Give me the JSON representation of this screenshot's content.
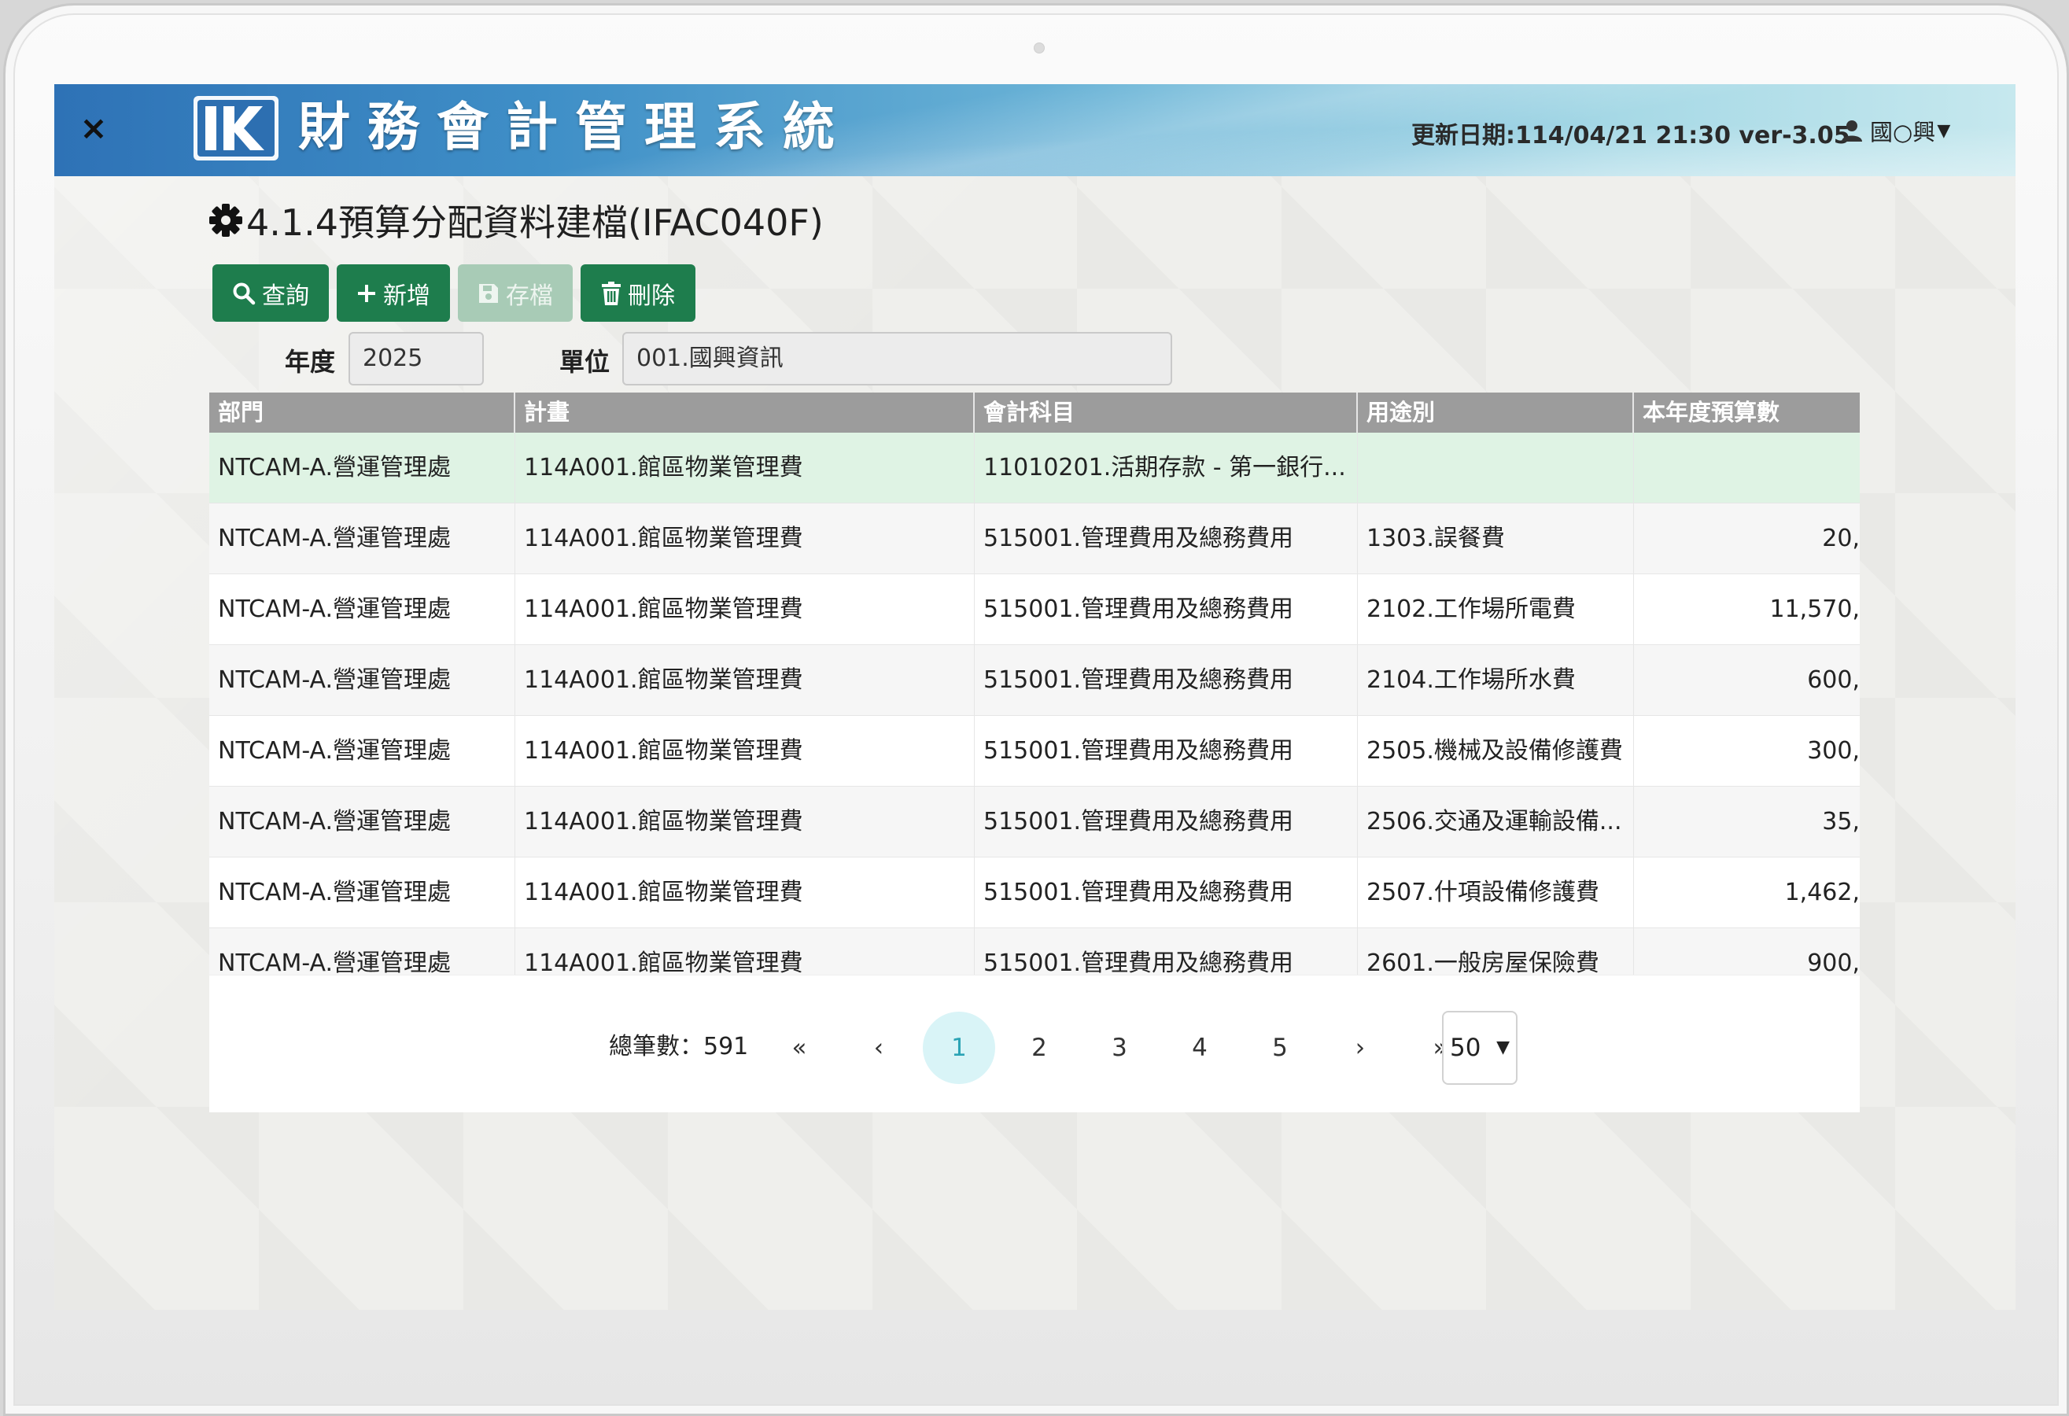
{
  "header": {
    "close_label": "×",
    "logo_text": "IK",
    "app_title": "財務會計管理系統",
    "update_info": "更新日期:114/04/21 21:30 ver-3.05",
    "user_name": "國○興"
  },
  "page": {
    "title": "4.1.4預算分配資料建檔(IFAC040F)"
  },
  "toolbar": {
    "query": "查詢",
    "add": "新增",
    "save": "存檔",
    "delete": "刪除"
  },
  "filters": {
    "year_label": "年度",
    "year_value": "2025",
    "unit_label": "單位",
    "unit_value": "001.國興資訊"
  },
  "table": {
    "columns": [
      "部門",
      "計畫",
      "會計科目",
      "用途別",
      "本年度預算數"
    ],
    "rows": [
      [
        "NTCAM-A.營運管理處",
        "114A001.館區物業管理費",
        "11010201.活期存款 - 第一銀行...",
        "",
        ""
      ],
      [
        "NTCAM-A.營運管理處",
        "114A001.館區物業管理費",
        "515001.管理費用及總務費用",
        "1303.誤餐費",
        "20,"
      ],
      [
        "NTCAM-A.營運管理處",
        "114A001.館區物業管理費",
        "515001.管理費用及總務費用",
        "2102.工作場所電費",
        "11,570,"
      ],
      [
        "NTCAM-A.營運管理處",
        "114A001.館區物業管理費",
        "515001.管理費用及總務費用",
        "2104.工作場所水費",
        "600,"
      ],
      [
        "NTCAM-A.營運管理處",
        "114A001.館區物業管理費",
        "515001.管理費用及總務費用",
        "2505.機械及設備修護費",
        "300,"
      ],
      [
        "NTCAM-A.營運管理處",
        "114A001.館區物業管理費",
        "515001.管理費用及總務費用",
        "2506.交通及運輸設備...",
        "35,"
      ],
      [
        "NTCAM-A.營運管理處",
        "114A001.館區物業管理費",
        "515001.管理費用及總務費用",
        "2507.什項設備修護費",
        "1,462,"
      ],
      [
        "NTCAM-A.營運管理處",
        "114A001.館區物業管理費",
        "515001.管理費用及總務費用",
        "2601.一般房屋保險費",
        "900,"
      ]
    ]
  },
  "pagination": {
    "total_label": "總筆數：",
    "total_value": "591",
    "first": "«",
    "prev": "‹",
    "pages": [
      "1",
      "2",
      "3",
      "4",
      "5"
    ],
    "active_page": "1",
    "next": "›",
    "last": "»",
    "page_size": "50"
  }
}
